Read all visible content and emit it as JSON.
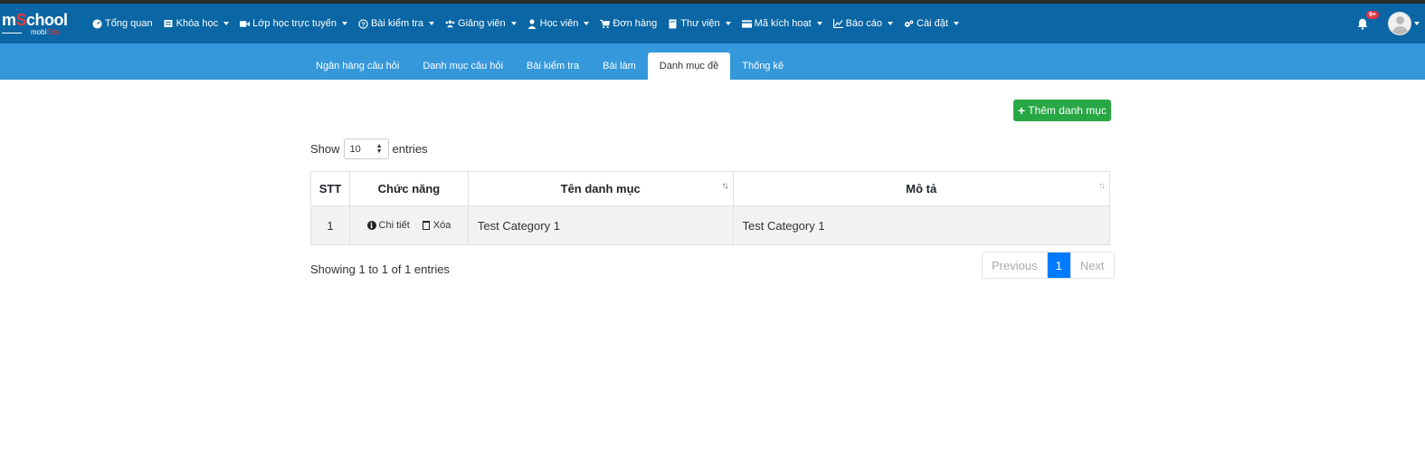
{
  "logo": {
    "main_pre": "m",
    "main_accent": "S",
    "main_post": "chool",
    "sub_pre": "mobi",
    "sub_accent": "Edu"
  },
  "nav": {
    "items": [
      {
        "label": "Tổng quan",
        "icon": "dashboard-icon",
        "dropdown": false
      },
      {
        "label": "Khóa học",
        "icon": "book-icon",
        "dropdown": true
      },
      {
        "label": "Lớp học trực tuyến",
        "icon": "video-icon",
        "dropdown": true
      },
      {
        "label": "Bài kiểm tra",
        "icon": "question-icon",
        "dropdown": true
      },
      {
        "label": "Giảng viên",
        "icon": "users-icon",
        "dropdown": true
      },
      {
        "label": "Học viên",
        "icon": "user-icon",
        "dropdown": true
      },
      {
        "label": "Đơn hàng",
        "icon": "cart-icon",
        "dropdown": false
      },
      {
        "label": "Thư viện",
        "icon": "library-icon",
        "dropdown": true
      },
      {
        "label": "Mã kích hoạt",
        "icon": "card-icon",
        "dropdown": true
      },
      {
        "label": "Báo cáo",
        "icon": "chart-icon",
        "dropdown": true
      },
      {
        "label": "Cài đặt",
        "icon": "gears-icon",
        "dropdown": true
      }
    ],
    "notification_badge": "9+"
  },
  "tabs": [
    {
      "label": "Ngân hàng câu hỏi",
      "active": false
    },
    {
      "label": "Danh mục câu hỏi",
      "active": false
    },
    {
      "label": "Bài kiểm tra",
      "active": false
    },
    {
      "label": "Bài làm",
      "active": false
    },
    {
      "label": "Danh mục đề",
      "active": true
    },
    {
      "label": "Thống kê",
      "active": false
    }
  ],
  "add_button": {
    "label": "Thêm danh mục"
  },
  "length_control": {
    "prefix": "Show",
    "value": "10",
    "suffix": "entries"
  },
  "table": {
    "headers": [
      "STT",
      "Chức năng",
      "Tên danh mục",
      "Mô tả"
    ],
    "rows": [
      {
        "stt": "1",
        "detail_label": "Chi tiết",
        "delete_label": "Xóa",
        "name": "Test Category 1",
        "description": "Test Category 1"
      }
    ]
  },
  "info_text": "Showing 1 to 1 of 1 entries",
  "pagination": {
    "previous": "Previous",
    "current": "1",
    "next": "Next"
  },
  "colors": {
    "navbar": "#0a66a4",
    "subnav": "#3498db",
    "add_button": "#28a745",
    "page_active": "#007bff"
  }
}
